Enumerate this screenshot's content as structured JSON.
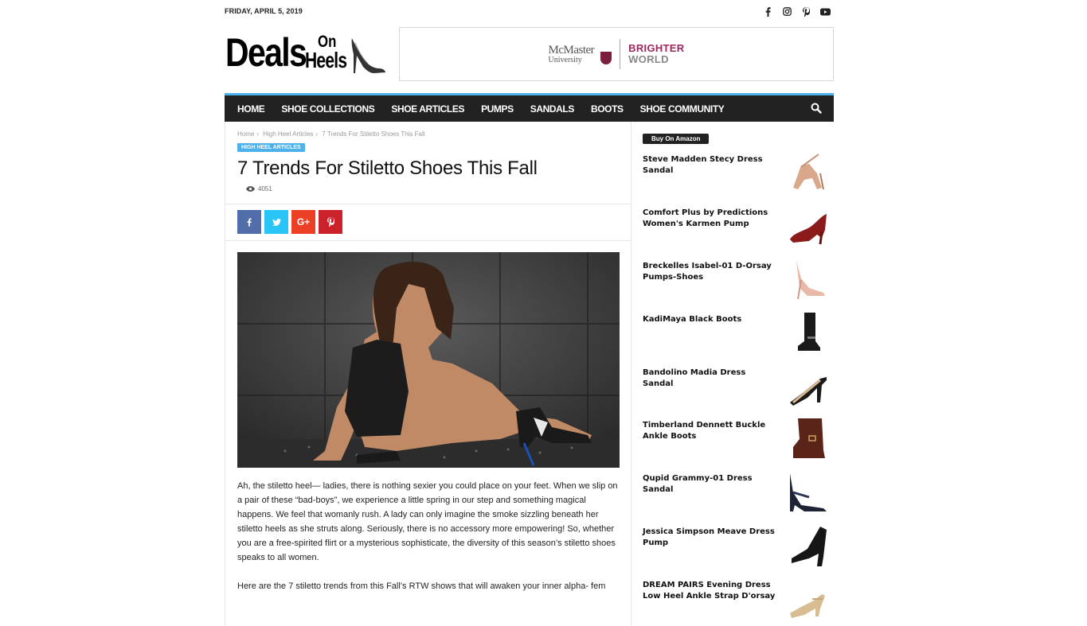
{
  "top_bar": {
    "date": "FRIDAY, APRIL 5, 2019",
    "social_icons": [
      "facebook-icon",
      "instagram-icon",
      "pinterest-icon",
      "youtube-icon"
    ]
  },
  "logo": {
    "word1": "Deals",
    "word2": "On",
    "word3": "Heels"
  },
  "banner": {
    "university_line1": "McMaster",
    "university_line2": "University",
    "slogan_line1": "BRIGHTER",
    "slogan_line2": "WORLD"
  },
  "nav": {
    "items": [
      "HOME",
      "SHOE COLLECTIONS",
      "SHOE ARTICLES",
      "PUMPS",
      "SANDALS",
      "BOOTS",
      "SHOE COMMUNITY"
    ],
    "accent_color": "#4db2ec",
    "bg_color": "#222222"
  },
  "article": {
    "breadcrumb": [
      "Home",
      "High Heel Articles",
      "7 Trends For Stiletto Shoes This Fall"
    ],
    "category": "HIGH HEEL ARTICLES",
    "title": "7 Trends For Stiletto Shoes This Fall",
    "views": "4051",
    "share": [
      {
        "icon": "facebook-icon",
        "glyph": "f",
        "color": "#516eab"
      },
      {
        "icon": "twitter-icon",
        "glyph": "t",
        "color": "#29c5f6"
      },
      {
        "icon": "google-plus-icon",
        "glyph": "G+",
        "color": "#eb4026"
      },
      {
        "icon": "pinterest-icon",
        "glyph": "P",
        "color": "#ca212a"
      }
    ],
    "paragraphs": [
      "Ah, the stiletto heel— ladies, there is nothing sexier you could place on your feet. When we slip on a pair of these “bad-boys”, we experience a little spring in our step and something magical happens. We feel that womanly rush. A lady can only imagine the smoke sizzling beneath her stiletto heels as she struts along. Seriously, there is no accessory more empowering! So, whether you are a free-spirited flirt or a mysterious sophisticate, the diversity of this season’s stiletto shoes speaks to all women.",
      "Here are the 7 stiletto trends from this Fall’s RTW shows that will awaken your inner alpha- fem"
    ]
  },
  "sidebar": {
    "header": "Buy On Amazon",
    "products": [
      "Steve Madden Stecy Dress Sandal",
      "Comfort Plus by Predictions Women's Karmen Pump",
      "Breckelles Isabel-01 D-Orsay Pumps-Shoes",
      "KadiMaya Black Boots",
      "Bandolino Madia Dress Sandal",
      "Timberland Dennett Buckle Ankle Boots",
      "Qupid Grammy-01 Dress Sandal",
      "Jessica Simpson Meave Dress Pump",
      "DREAM PAIRS Evening Dress Low Heel Ankle Strap D'orsay"
    ]
  }
}
